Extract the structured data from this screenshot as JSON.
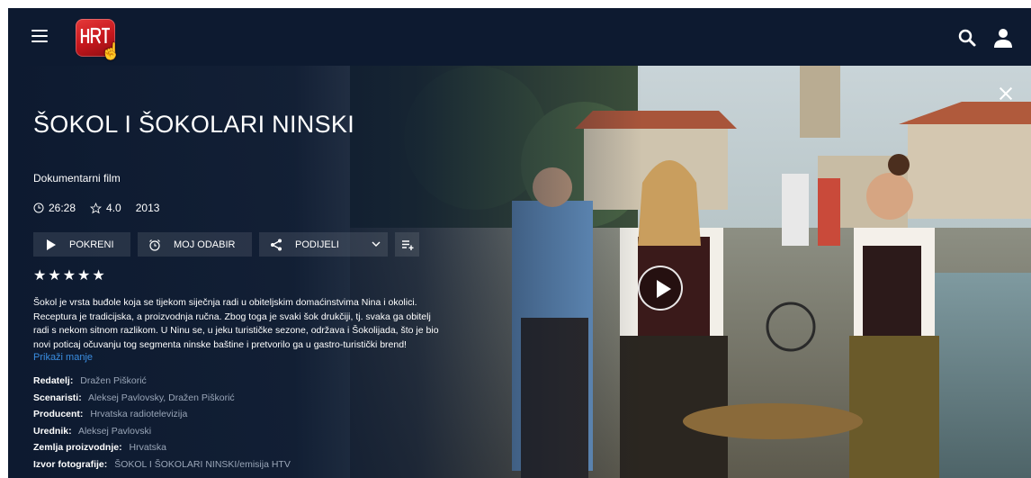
{
  "header": {
    "menu_icon": "hamburger-menu-icon",
    "logo_text": "HRT",
    "search_icon": "search-icon",
    "user_icon": "user-icon"
  },
  "hero": {
    "close_icon": "close-icon",
    "play_icon": "play-circle-icon",
    "title": "ŠOKOL I ŠOKOLARI NINSKI",
    "genre": "Dokumentarni film",
    "duration": "26:28",
    "rating": "4.0",
    "year": "2013",
    "actions": {
      "play_label": "POKRENI",
      "fav_label": "MOJ ODABIR",
      "share_label": "PODIJELI"
    },
    "stars": "★★★★★",
    "description": "Šokol je vrsta buđole koja se tijekom siječnja radi u obiteljskim domaćinstvima Nina i okolici. Receptura je tradicijska, a proizvodnja ručna. Zbog toga je svaki šok drukčiji, tj. svaka ga obitelj radi s nekom sitnom razlikom. U Ninu se, u jeku turističke sezone, održava i Šokolijada, što je bio novi poticaj očuvanju tog segmenta ninske baštine i pretvorilo ga u gastro-turistički brend!",
    "show_less": "Prikaži manje",
    "credits": [
      {
        "label": "Redatelj:",
        "value": "Dražen Piškorić"
      },
      {
        "label": "Scenaristi:",
        "value": "Aleksej Pavlovsky, Dražen Piškorić"
      },
      {
        "label": "Producent:",
        "value": "Hrvatska radiotelevizija"
      },
      {
        "label": "Urednik:",
        "value": "Aleksej Pavlovski"
      },
      {
        "label": "Zemlja proizvodnje:",
        "value": "Hrvatska"
      },
      {
        "label": "Izvor fotografije:",
        "value": "ŠOKOL I ŠOKOLARI NINSKI/emisija HTV"
      }
    ]
  },
  "colors": {
    "background": "#0d1a30",
    "logo_red": "#c4161c",
    "link_blue": "#3a8de0",
    "muted_text": "#9aa6b8"
  }
}
